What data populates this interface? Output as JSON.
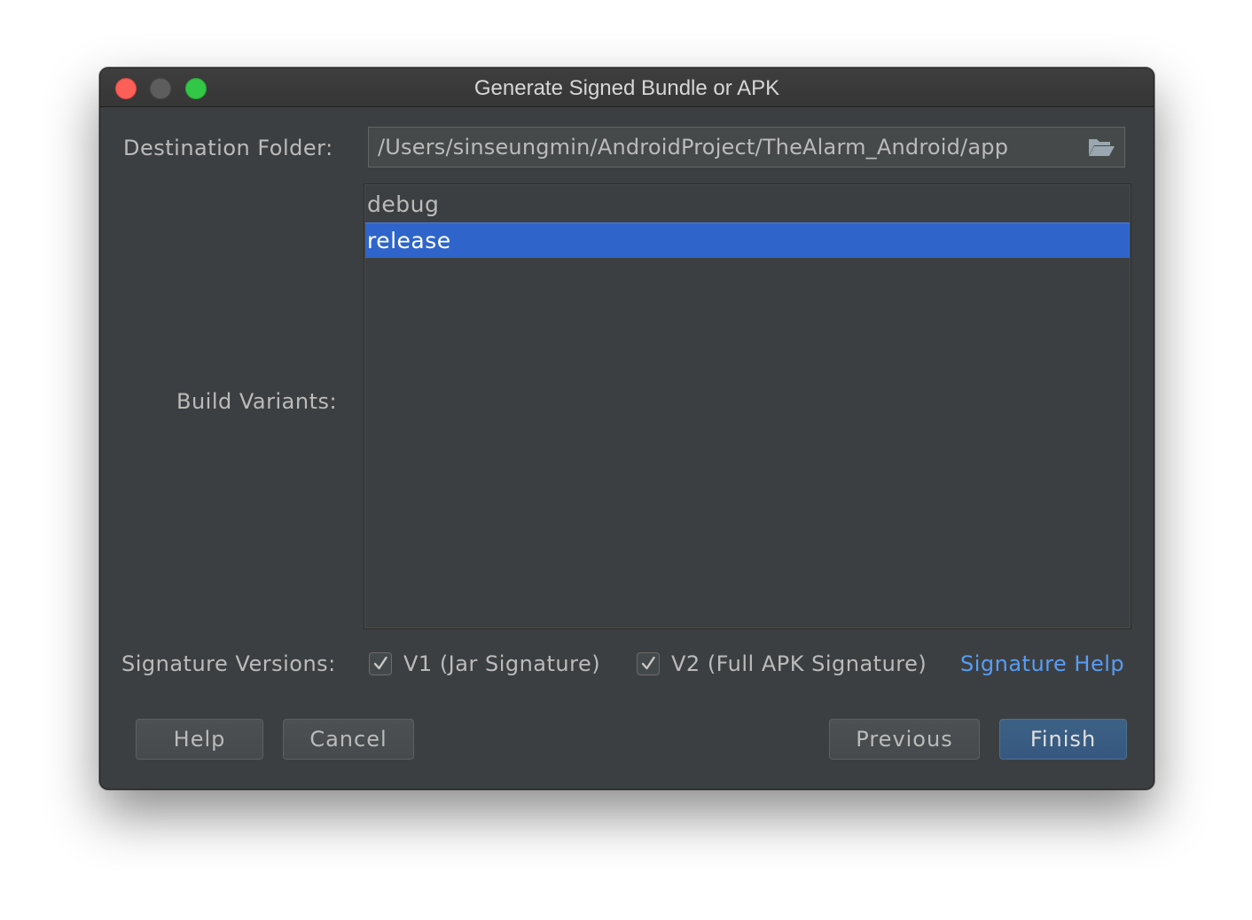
{
  "window": {
    "title": "Generate Signed Bundle or APK"
  },
  "destination": {
    "label": "Destination Folder:",
    "value": "/Users/sinseungmin/AndroidProject/TheAlarm_Android/app",
    "browse_icon": "folder-open-icon"
  },
  "build_variants": {
    "label": "Build Variants:",
    "items": [
      {
        "label": "debug",
        "selected": false
      },
      {
        "label": "release",
        "selected": true
      }
    ]
  },
  "signature": {
    "label": "Signature Versions:",
    "v1": {
      "label": "V1 (Jar Signature)",
      "checked": true
    },
    "v2": {
      "label": "V2 (Full APK Signature)",
      "checked": true
    },
    "help_link": "Signature Help"
  },
  "buttons": {
    "help": "Help",
    "cancel": "Cancel",
    "previous": "Previous",
    "finish": "Finish"
  },
  "colors": {
    "background": "#3c3f41",
    "selection": "#2f65ca",
    "link": "#589df6",
    "primary_button": "#365880",
    "close": "#fc5f57",
    "minimize": "#5d5d5d",
    "maximize": "#33c748"
  }
}
